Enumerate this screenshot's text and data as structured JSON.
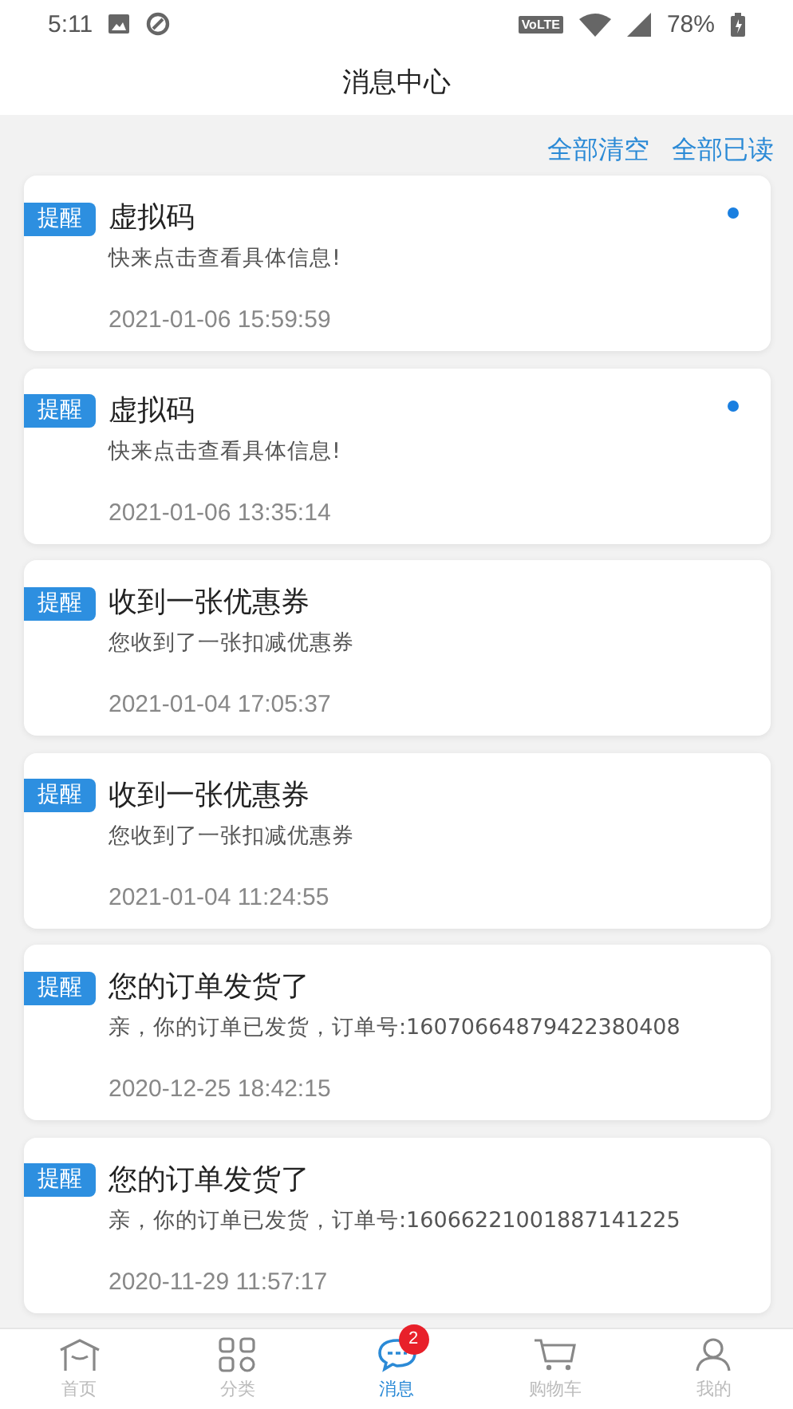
{
  "status_bar": {
    "time": "5:11",
    "network_label": "VoLTE",
    "battery": "78%"
  },
  "header": {
    "title": "消息中心"
  },
  "actions": [
    "全部清空",
    "全部已读"
  ],
  "messages": [
    {
      "tag": "提醒",
      "title": "虚拟码",
      "body": "快来点击查看具体信息!",
      "date": "2021-01-06 15:59:59",
      "unread": true
    },
    {
      "tag": "提醒",
      "title": "虚拟码",
      "body": "快来点击查看具体信息!",
      "date": "2021-01-06 13:35:14",
      "unread": true
    },
    {
      "tag": "提醒",
      "title": "收到一张优惠券",
      "body": "您收到了一张扣减优惠券",
      "date": "2021-01-04 17:05:37",
      "unread": false
    },
    {
      "tag": "提醒",
      "title": "收到一张优惠券",
      "body": "您收到了一张扣减优惠券",
      "date": "2021-01-04 11:24:55",
      "unread": false
    },
    {
      "tag": "提醒",
      "title": "您的订单发货了",
      "body": "亲，你的订单已发货，订单号:16070664879422380408",
      "date": "2020-12-25 18:42:15",
      "unread": false
    },
    {
      "tag": "提醒",
      "title": "您的订单发货了",
      "body": "亲，你的订单已发货，订单号:16066221001887141225",
      "date": "2020-11-29 11:57:17",
      "unread": false
    }
  ],
  "tab_bar": [
    {
      "kind": "home",
      "label": "首页",
      "selected": false
    },
    {
      "kind": "category",
      "label": "分类",
      "selected": false
    },
    {
      "kind": "message",
      "label": "消息",
      "selected": true,
      "badge": "2"
    },
    {
      "kind": "cart",
      "label": "购物车",
      "selected": false
    },
    {
      "kind": "profile",
      "label": "我的",
      "selected": false
    }
  ]
}
